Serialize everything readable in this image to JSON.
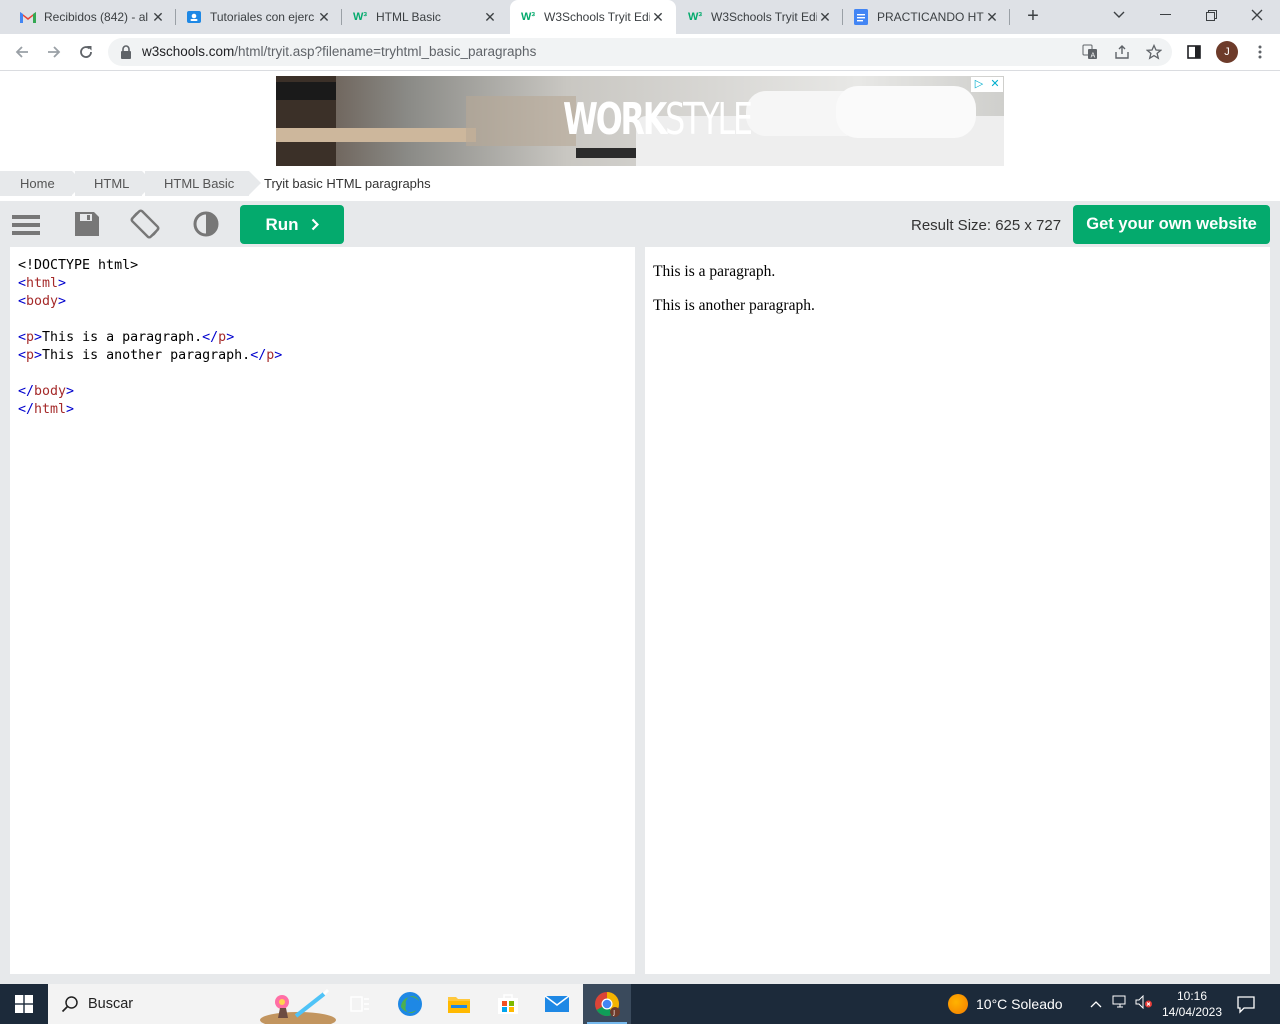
{
  "browser": {
    "tabs": [
      {
        "title": "Recibidos (842) - al",
        "icon": "gmail-icon"
      },
      {
        "title": "Tutoriales con ejerc",
        "icon": "classroom-icon"
      },
      {
        "title": "HTML Basic",
        "icon": "w3schools-icon"
      },
      {
        "title": "W3Schools Tryit Edi",
        "icon": "w3schools-icon",
        "active": true
      },
      {
        "title": "W3Schools Tryit Edi",
        "icon": "w3schools-icon"
      },
      {
        "title": "PRACTICANDO HTM",
        "icon": "docs-icon"
      }
    ],
    "url_host": "w3schools.com",
    "url_path": "/html/tryit.asp?filename=tryhtml_basic_paragraphs",
    "profile_initial": "J"
  },
  "ad": {
    "brand_bold": "WORK",
    "brand_light": "STYLE"
  },
  "breadcrumb": {
    "items": [
      "Home",
      "HTML",
      "HTML Basic"
    ],
    "current": "Tryit basic HTML paragraphs"
  },
  "toolbar": {
    "run_label": "Run",
    "result_size": "Result Size: 625 x 727",
    "get_website_label": "Get your own website"
  },
  "editor": {
    "lines": [
      "<!DOCTYPE html>",
      "<html>",
      "<body>",
      "",
      "<p>This is a paragraph.</p>",
      "<p>This is another paragraph.</p>",
      "",
      "</body>",
      "</html>"
    ]
  },
  "result": {
    "paragraphs": [
      "This is a paragraph.",
      "This is another paragraph."
    ]
  },
  "taskbar": {
    "search_label": "Buscar",
    "weather": "10°C  Soleado",
    "time": "10:16",
    "date": "14/04/2023"
  },
  "colors": {
    "accent": "#04aa6d",
    "tag": "#a52a2a",
    "bracket": "#0000cd"
  }
}
